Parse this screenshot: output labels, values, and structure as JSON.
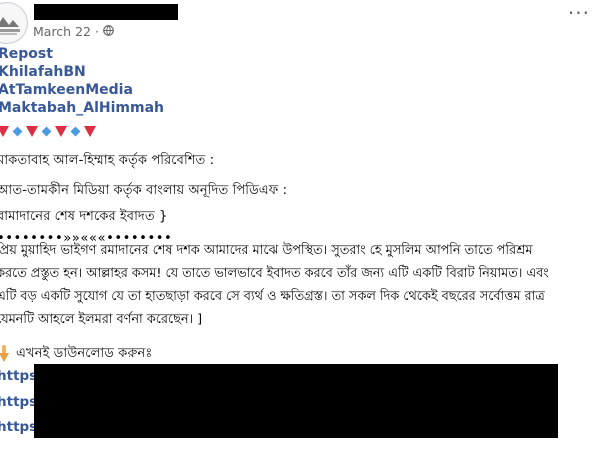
{
  "post": {
    "date": "March 22",
    "separator": "·",
    "audience_icon": "globe-icon",
    "more_icon": "more-options-icon",
    "more_glyph": "···"
  },
  "tags": [
    "Repost",
    "KhilafahBN",
    "AtTamkeenMedia",
    "Maktabah_AlHimmah"
  ],
  "emoji_row": [
    "red-triangle-down",
    "blue-diamond",
    "red-triangle-down",
    "blue-diamond",
    "red-triangle-down",
    "blue-diamond",
    "red-triangle-down"
  ],
  "lines": {
    "line1": "মাকতাবাহ আল-হিম্মাহ কর্তৃক পরিবেশিত :",
    "line2": "আত-তামকীন মিডিয়া কর্তৃক বাংলায় অনূদিত পিডিএফ :",
    "line3": "রামাদানের শেষ দশকের ইবাদত  }",
    "divider": "••••••••»»«««••••••••"
  },
  "paragraph": [
    "প্রিয় মুয়াহিদ ভাইগণ রমাদানের শেষ দশক আমাদের মাঝে উপস্থিত। সুতরাং হে মুসলিম আপনি তাতে পরিশ্রম",
    "করতে প্রস্তুত হন। আল্লাহর কসম! যে তাতে ভালভাবে ইবাদত করবে তাঁর জন্য এটি একটি বিরাট নিয়ামত। এবং",
    "এটি বড় একটি সুযোগ যে তা হাতছাড়া করবে সে ব্যর্থ ও ক্ষতিগ্রস্ত। তা সকল দিক থেকেই বছরের সর্বোত্তম রাত্র",
    "যেমনটি আহলে ইলমরা বর্ণনা করেছেন। ]"
  ],
  "download": {
    "icon": "pointing-down-icon",
    "label": "এখনই ডাউনলোড করুনঃ"
  },
  "links": [
    "https:",
    "https:",
    "https:"
  ],
  "colors": {
    "link": "#385898",
    "meta": "#65676b",
    "text": "#050505",
    "triangle": "#dd2e44",
    "diamond": "#4a9be0"
  }
}
